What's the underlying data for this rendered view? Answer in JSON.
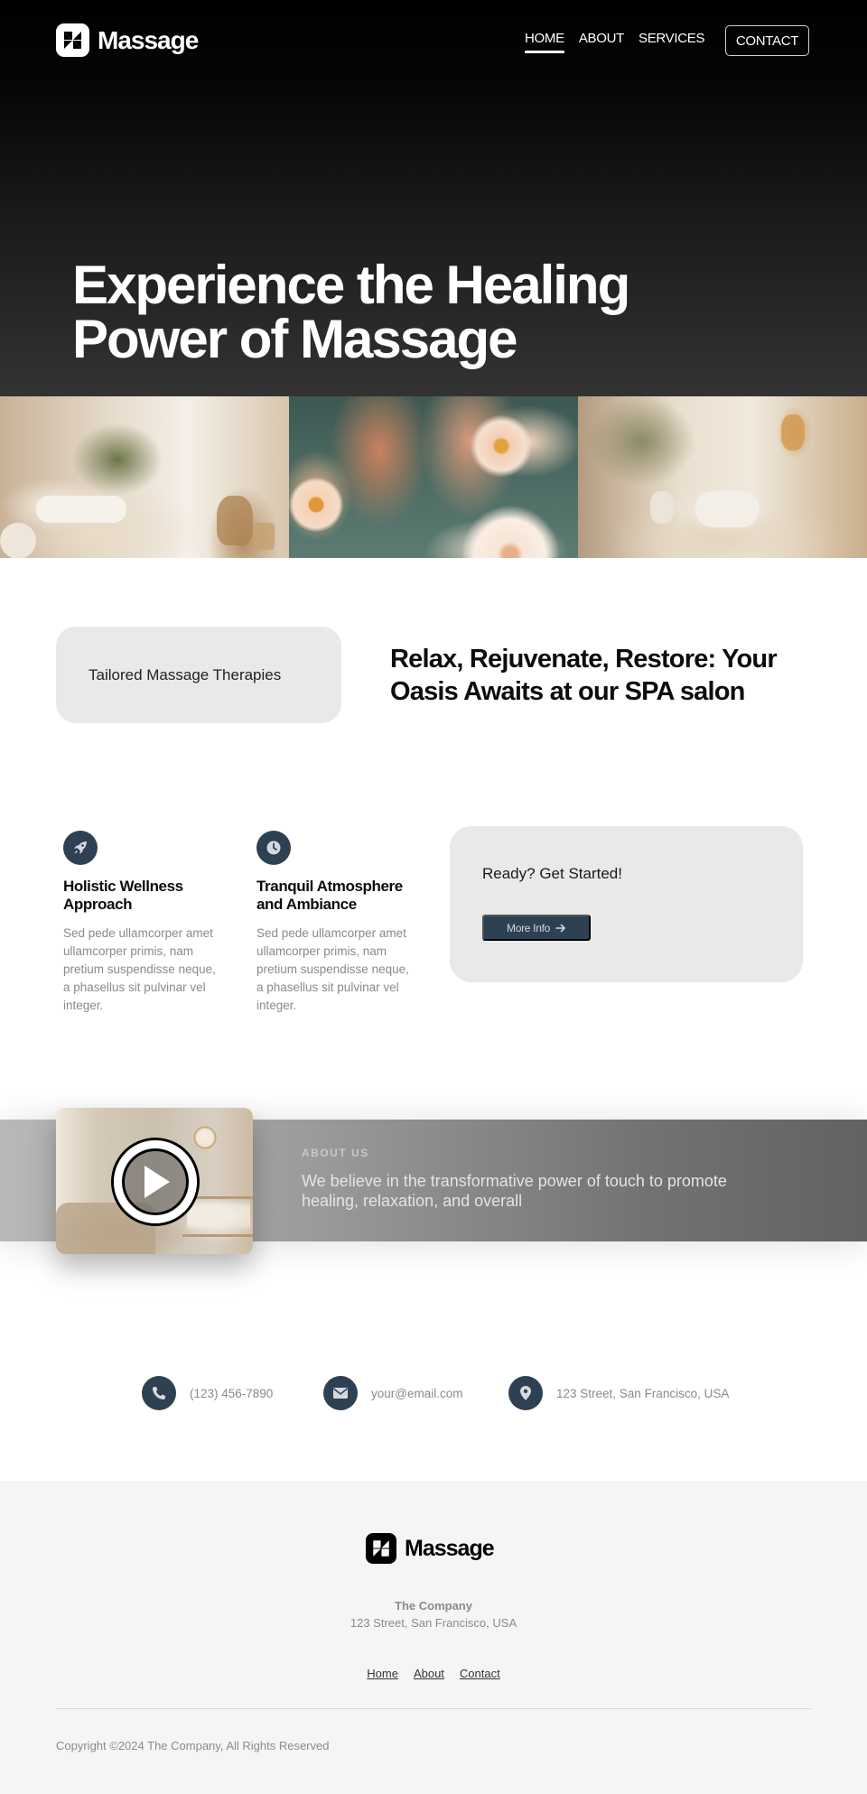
{
  "header": {
    "logo_text": "Massage",
    "nav": [
      {
        "label": "HOME",
        "active": true
      },
      {
        "label": "ABOUT",
        "active": false
      },
      {
        "label": "SERVICES",
        "active": false
      }
    ],
    "contact_label": "CONTACT"
  },
  "hero": {
    "title_line1": "Experience the Healing",
    "title_line2": "Power of Massage"
  },
  "gallery": {
    "images": [
      {
        "alt": "Spa room with massage bed and towels"
      },
      {
        "alt": "Feet in water with flowers"
      },
      {
        "alt": "Spa room with rolled towels and lamp"
      }
    ]
  },
  "intro": {
    "card_label": "Tailored Massage Therapies",
    "heading": "Relax, Rejuvenate, Restore: Your Oasis Awaits at our SPA salon"
  },
  "features": [
    {
      "icon": "rocket-icon",
      "title": "Holistic Wellness Approach",
      "text": "Sed pede ullamcorper amet ullamcorper primis, nam pretium suspendisse neque, a phasellus sit pulvinar vel integer."
    },
    {
      "icon": "clock-icon",
      "title": "Tranquil Atmosphere and Ambiance",
      "text": "Sed pede ullamcorper amet ullamcorper primis, nam pretium suspendisse neque, a phasellus sit pulvinar vel integer."
    }
  ],
  "cta": {
    "title": "Ready? Get Started!",
    "button_label": "More Info"
  },
  "about": {
    "label": "ABOUT US",
    "text": "We believe in the transformative power of touch to promote healing, relaxation, and overall"
  },
  "contact": {
    "phone": "(123) 456-7890",
    "email": "your@email.com",
    "address": "123 Street, San Francisco, USA"
  },
  "footer": {
    "logo_text": "Massage",
    "company": "The Company",
    "address": "123 Street, San Francisco, USA",
    "links": [
      "Home",
      "About",
      "Contact"
    ],
    "copyright": "Copyright ©2024 The Company, All Rights Reserved"
  },
  "colors": {
    "accent": "#2d4153",
    "card_bg": "#e8e9eb",
    "footer_bg": "#f5f5f5",
    "muted_text": "#8a8a8a"
  }
}
